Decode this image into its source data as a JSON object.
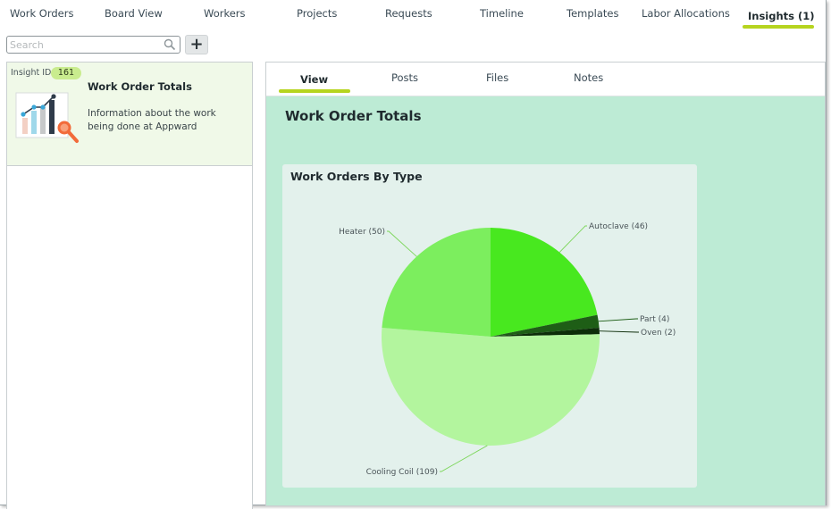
{
  "nav": {
    "tabs": [
      "Work Orders",
      "Board View",
      "Workers",
      "Projects",
      "Requests",
      "Timeline",
      "Templates",
      "Labor Allocations"
    ],
    "active_tab": "Insights (1)"
  },
  "search": {
    "placeholder": "Search",
    "add_label": "+"
  },
  "insight_card": {
    "id_label": "Insight ID",
    "id_value": "161",
    "title": "Work Order Totals",
    "description": "Information about the work being done at Appward"
  },
  "detail": {
    "tabs": [
      "View",
      "Posts",
      "Files",
      "Notes"
    ],
    "active_tab_index": 0,
    "title": "Work Order Totals"
  },
  "colors": {
    "accent": "#b6d41f",
    "panel_bg": "#bdebd5",
    "card_bg": "#f0f9e8"
  },
  "chart_data": {
    "type": "pie",
    "title": "Work Orders By Type",
    "slices": [
      {
        "label": "Autoclave (46)",
        "value": 46,
        "color": "#48e81f"
      },
      {
        "label": "Part (4)",
        "value": 4,
        "color": "#1e5e16"
      },
      {
        "label": "Oven (2)",
        "value": 2,
        "color": "#0d2d09"
      },
      {
        "label": "Cooling Coil (109)",
        "value": 109,
        "color": "#b3f59e"
      },
      {
        "label": "Heater (50)",
        "value": 50,
        "color": "#7cee5e"
      }
    ]
  }
}
